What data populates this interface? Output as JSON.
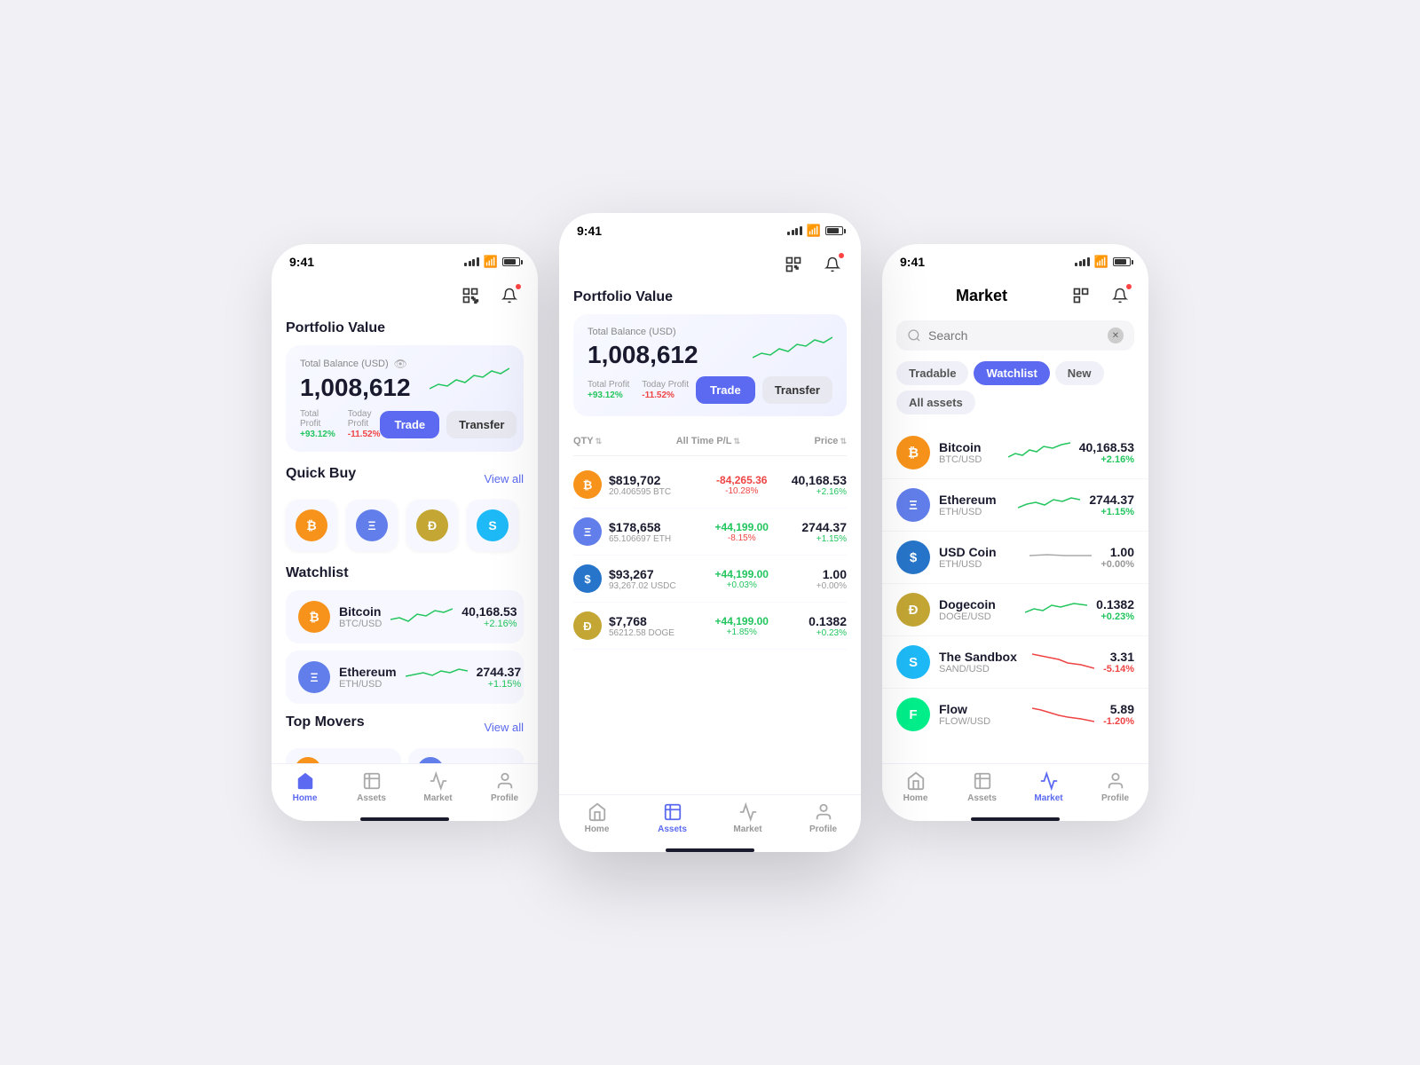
{
  "app": {
    "time": "9:41",
    "screens": {
      "home": {
        "title": "Portfolio Value",
        "balance_label": "Total Balance (USD)",
        "balance_amount": "1,008,612",
        "total_profit_label": "Total Profit",
        "total_profit_val": "+93.12%",
        "today_profit_label": "Today Profit",
        "today_profit_val": "-11.52%",
        "trade_btn": "Trade",
        "transfer_btn": "Transfer",
        "quick_buy_title": "Quick Buy",
        "view_all": "View all",
        "watchlist_title": "Watchlist",
        "top_movers_title": "Top Movers",
        "quick_buy_coins": [
          {
            "symbol": "₿",
            "color": "btc-color"
          },
          {
            "symbol": "Ξ",
            "color": "eth-color"
          },
          {
            "symbol": "Ð",
            "color": "doge-color"
          },
          {
            "symbol": "S",
            "color": "sand-color"
          }
        ],
        "watchlist": [
          {
            "name": "Bitcoin",
            "pair": "BTC/USD",
            "price": "40,168.53",
            "change": "+2.16%",
            "positive": true
          },
          {
            "name": "Ethereum",
            "pair": "ETH/USD",
            "price": "2744.37",
            "change": "+1.15%",
            "positive": true
          }
        ],
        "nav": [
          "Home",
          "Assets",
          "Market",
          "Profile"
        ],
        "active_nav": 0
      },
      "assets": {
        "title": "Portfolio Value",
        "balance_label": "Total Balance (USD)",
        "balance_amount": "1,008,612",
        "total_profit_label": "Total Profit",
        "total_profit_val": "+93.12%",
        "today_profit_label": "Today Profit",
        "today_profit_val": "-11.52%",
        "trade_btn": "Trade",
        "transfer_btn": "Transfer",
        "table_headers": {
          "qty": "QTY",
          "pnl": "All Time  P/L",
          "price": "Price"
        },
        "rows": [
          {
            "icon_color": "btc-color",
            "symbol": "₿",
            "value": "$819,702",
            "qty": "20.406595 BTC",
            "pnl": "-84,265.36",
            "pnl_pct": "-10.28%",
            "pnl_pos": false,
            "price": "40,168.53",
            "price_chg": "+2.16%",
            "price_pos": true
          },
          {
            "icon_color": "eth-color",
            "symbol": "Ξ",
            "value": "$178,658",
            "qty": "65.106697 ETH",
            "pnl": "+44,199.00",
            "pnl_pct": "-8.15%",
            "pnl_pos": true,
            "price": "2744.37",
            "price_chg": "+1.15%",
            "price_pos": true
          },
          {
            "icon_color": "usdc-color",
            "symbol": "$",
            "value": "$93,267",
            "qty": "93,267.02 USDC",
            "pnl": "+44,199.00",
            "pnl_pct": "+0.03%",
            "pnl_pos": true,
            "price": "1.00",
            "price_chg": "+0.00%",
            "price_pos": true
          },
          {
            "icon_color": "doge-color",
            "symbol": "Ð",
            "value": "$7,768",
            "qty": "56212.58 DOGE",
            "pnl": "+44,199.00",
            "pnl_pct": "+1.85%",
            "pnl_pos": true,
            "price": "0.1382",
            "price_chg": "+0.23%",
            "price_pos": true
          }
        ],
        "nav": [
          "Home",
          "Assets",
          "Market",
          "Profile"
        ],
        "active_nav": 1
      },
      "market": {
        "page_title": "Market",
        "search_placeholder": "Search",
        "filter_tabs": [
          "Tradable",
          "Watchlist",
          "New",
          "All assets"
        ],
        "active_filter": 1,
        "coins": [
          {
            "name": "Bitcoin",
            "pair": "BTC/USD",
            "price": "40,168.53",
            "change": "+2.16%",
            "positive": true,
            "icon_color": "btc-color",
            "symbol": "₿"
          },
          {
            "name": "Ethereum",
            "pair": "ETH/USD",
            "price": "2744.37",
            "change": "+1.15%",
            "positive": true,
            "icon_color": "eth-color",
            "symbol": "Ξ"
          },
          {
            "name": "USD Coin",
            "pair": "ETH/USD",
            "price": "1.00",
            "change": "+0.00%",
            "neutral": true,
            "icon_color": "usdc-color",
            "symbol": "$"
          },
          {
            "name": "Dogecoin",
            "pair": "DOGE/USD",
            "price": "0.1382",
            "change": "+0.23%",
            "positive": true,
            "icon_color": "doge-color",
            "symbol": "Ð"
          },
          {
            "name": "The Sandbox",
            "pair": "SAND/USD",
            "price": "3.31",
            "change": "-5.14%",
            "positive": false,
            "icon_color": "sand-color",
            "symbol": "S"
          },
          {
            "name": "Flow",
            "pair": "FLOW/USD",
            "price": "5.89",
            "change": "-1.20%",
            "positive": false,
            "icon_color": "flow-color",
            "symbol": "F"
          }
        ],
        "nav": [
          "Home",
          "Assets",
          "Market",
          "Profile"
        ],
        "active_nav": 2
      }
    }
  }
}
